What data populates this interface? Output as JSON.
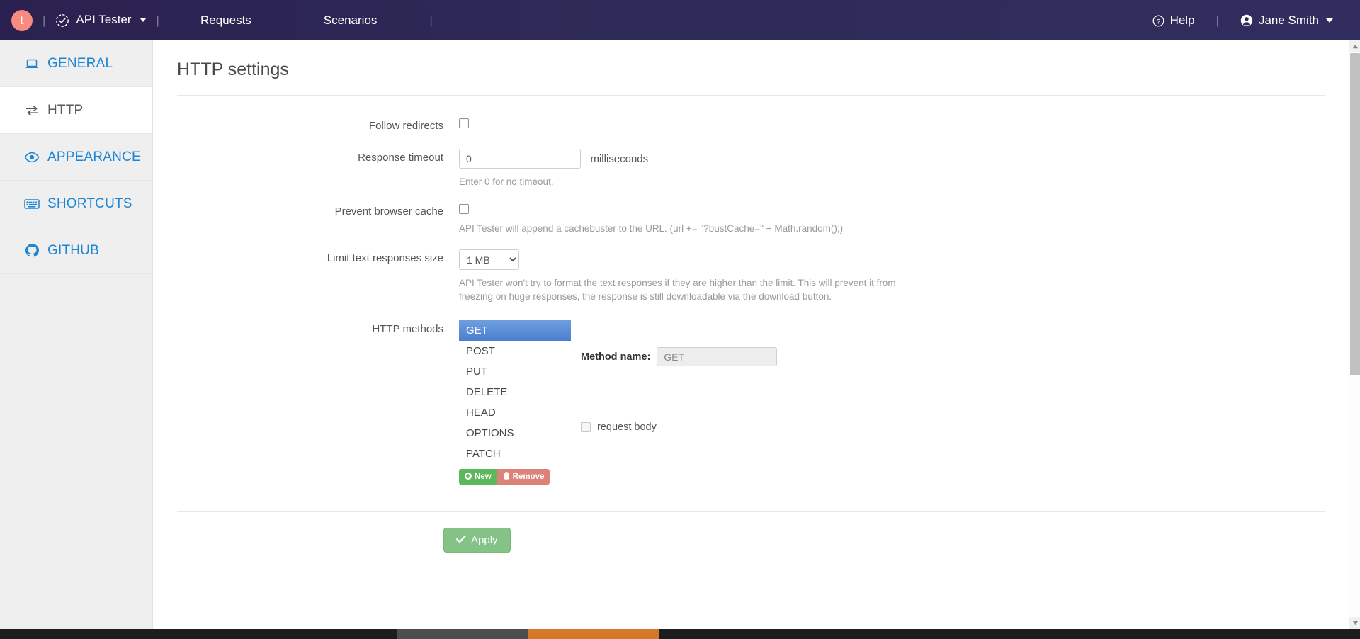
{
  "topnav": {
    "logo_letter": "t",
    "separator": "|",
    "brand": "API Tester",
    "links": [
      {
        "label": "Requests"
      },
      {
        "label": "Scenarios"
      }
    ],
    "help_label": "Help",
    "user_label": "Jane Smith"
  },
  "sidebar": {
    "items": [
      {
        "label": "GENERAL",
        "icon": "laptop-icon"
      },
      {
        "label": "HTTP",
        "icon": "exchange-arrows-icon"
      },
      {
        "label": "APPEARANCE",
        "icon": "eye-icon"
      },
      {
        "label": "SHORTCUTS",
        "icon": "keyboard-icon"
      },
      {
        "label": "GITHUB",
        "icon": "github-icon"
      }
    ]
  },
  "main": {
    "title": "HTTP settings",
    "follow_redirects": {
      "label": "Follow redirects",
      "checked": false
    },
    "response_timeout": {
      "label": "Response timeout",
      "value": "0",
      "suffix": "milliseconds",
      "help": "Enter 0 for no timeout."
    },
    "prevent_browser_cache": {
      "label": "Prevent browser cache",
      "checked": false,
      "help": "API Tester will append a cachebuster to the URL. (url += \"?bustCache=\" + Math.random();)"
    },
    "limit_text_responses": {
      "label": "Limit text responses size",
      "selected": "1 MB",
      "options": [
        "1 MB"
      ],
      "help": "API Tester won't try to format the text responses if they are higher than the limit. This will prevent it from freezing on huge responses, the response is still downloadable via the download button."
    },
    "http_methods": {
      "label": "HTTP methods",
      "options": [
        "GET",
        "POST",
        "PUT",
        "DELETE",
        "HEAD",
        "OPTIONS",
        "PATCH"
      ],
      "selected": "GET",
      "new_label": "New",
      "remove_label": "Remove",
      "method_name_label": "Method name:",
      "method_name_value": "GET",
      "request_body_label": "request body",
      "request_body_checked": false
    },
    "apply_label": "Apply"
  },
  "colors": {
    "navbar": "#2e2a57",
    "accent_link": "#1c86d4",
    "selected_row": "#4a7fd0",
    "success": "#5cb85c",
    "danger": "#dd8279",
    "apply": "#85c285"
  }
}
